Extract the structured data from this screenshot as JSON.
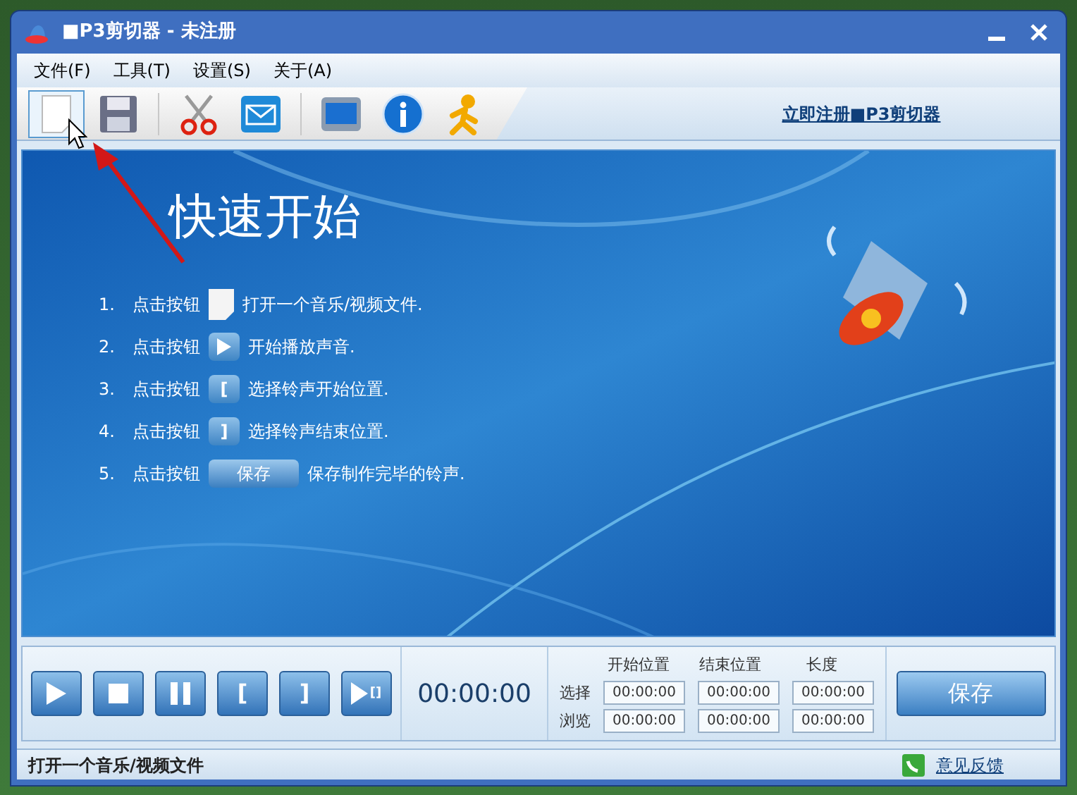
{
  "window": {
    "title": "■P3剪切器 - 未注册"
  },
  "menu": [
    {
      "label": "文件(F)"
    },
    {
      "label": "工具(T)"
    },
    {
      "label": "设置(S)"
    },
    {
      "label": "关于(A)"
    }
  ],
  "toolbar": {
    "buttons": [
      {
        "kind": "new",
        "selected": true
      },
      {
        "kind": "save",
        "selected": false
      },
      {
        "kind": "cut",
        "selected": false
      },
      {
        "kind": "mail",
        "selected": false
      },
      {
        "kind": "screen",
        "selected": false
      },
      {
        "kind": "info",
        "selected": false
      },
      {
        "kind": "person",
        "selected": false
      }
    ],
    "register_link": "立即注册■P3剪切器"
  },
  "quick_start": {
    "title": "快速开始",
    "steps": [
      {
        "number": "1.",
        "prefix": "点击按钮",
        "kind": "file",
        "text": "打开一个音乐/视频文件."
      },
      {
        "number": "2.",
        "prefix": "点击按钮",
        "kind": "play",
        "text": "开始播放声音."
      },
      {
        "number": "3.",
        "prefix": "点击按钮",
        "kind": "mark_start",
        "symbol": "[",
        "text": "选择铃声开始位置."
      },
      {
        "number": "4.",
        "prefix": "点击按钮",
        "kind": "mark_end",
        "symbol": "]",
        "text": "选择铃声结束位置."
      },
      {
        "number": "5.",
        "prefix": "点击按钮",
        "kind": "save",
        "button_label": "保存",
        "text": "保存制作完毕的铃声."
      }
    ]
  },
  "player": {
    "buttons": [
      {
        "kind": "play"
      },
      {
        "kind": "stop"
      },
      {
        "kind": "pause"
      },
      {
        "kind": "mark_start",
        "symbol": "["
      },
      {
        "kind": "mark_end",
        "symbol": "]"
      },
      {
        "kind": "play_selection",
        "symbol": "[]"
      }
    ],
    "time": "00:00:00",
    "columns": [
      "开始位置",
      "结束位置",
      "长度"
    ],
    "rows": [
      {
        "label": "选择",
        "values": [
          "00:00:00",
          "00:00:00",
          "00:00:00"
        ]
      },
      {
        "label": "浏览",
        "values": [
          "00:00:00",
          "00:00:00",
          "00:00:00"
        ]
      }
    ],
    "save_button": "保存"
  },
  "status_bar": {
    "text": "打开一个音乐/视频文件",
    "feedback_link": "意见反馈"
  }
}
